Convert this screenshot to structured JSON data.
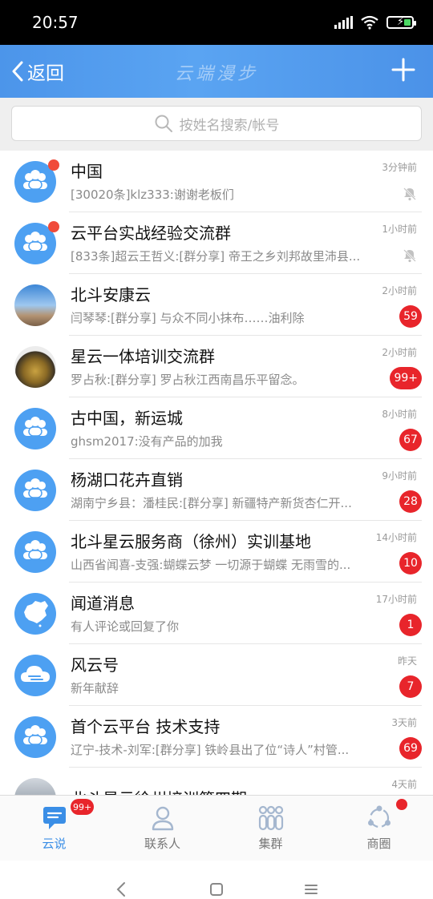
{
  "status": {
    "time": "20:57"
  },
  "nav": {
    "back_label": "返回",
    "watermark": "云端漫步"
  },
  "search": {
    "placeholder": "按姓名搜索/帐号"
  },
  "chats": [
    {
      "name": "中国",
      "preview": "[30020条]klz333:谢谢老板们",
      "time": "3分钟前",
      "badge": "",
      "muted": true,
      "avatar": "group",
      "dot": true
    },
    {
      "name": "云平台实战经验交流群",
      "preview": "[833条]超云王哲义:[群分享] 帝王之乡刘邦故里沛县...",
      "time": "1小时前",
      "badge": "",
      "muted": true,
      "avatar": "group",
      "dot": true
    },
    {
      "name": "北斗安康云",
      "preview": "闫琴琴:[群分享] 与众不同小抹布……油利除",
      "time": "2小时前",
      "badge": "59",
      "muted": false,
      "avatar": "photo1",
      "dot": false
    },
    {
      "name": "星云一体培训交流群",
      "preview": "罗占秋:[群分享] 罗占秋江西南昌乐平留念。",
      "time": "2小时前",
      "badge": "99+",
      "muted": false,
      "avatar": "photo2",
      "dot": false
    },
    {
      "name": "古中国，新运城",
      "preview": "ghsm2017:没有产品的加我",
      "time": "8小时前",
      "badge": "67",
      "muted": false,
      "avatar": "group",
      "dot": false
    },
    {
      "name": "杨湖口花卉直销",
      "preview": "湖南宁乡县：潘桂民:[群分享] 新疆特产新货杏仁开...",
      "time": "9小时前",
      "badge": "28",
      "muted": false,
      "avatar": "group",
      "dot": false
    },
    {
      "name": "北斗星云服务商（徐州）实训基地",
      "preview": "山西省闻喜-支强:蝴蝶云梦  一切源于蝴蝶 无雨雪的...",
      "time": "14小时前",
      "badge": "10",
      "muted": false,
      "avatar": "group",
      "dot": false
    },
    {
      "name": "闻道消息",
      "preview": "有人评论或回复了你",
      "time": "17小时前",
      "badge": "1",
      "muted": false,
      "avatar": "china",
      "dot": false
    },
    {
      "name": "风云号",
      "preview": "新年献辞",
      "time": "昨天",
      "badge": "7",
      "muted": false,
      "avatar": "cloud",
      "dot": false
    },
    {
      "name": "首个云平台 技术支持",
      "preview": "辽宁-技术-刘军:[群分享] 铁岭县出了位“诗人”村管...",
      "time": "3天前",
      "badge": "69",
      "muted": false,
      "avatar": "group",
      "dot": false
    },
    {
      "name": "北斗星云徐州培训第四期",
      "preview": "",
      "time": "4天前",
      "badge": "",
      "muted": false,
      "avatar": "photo3",
      "dot": false
    }
  ],
  "tabs": [
    {
      "label": "云说",
      "badge": "99+"
    },
    {
      "label": "联系人",
      "badge": ""
    },
    {
      "label": "集群",
      "badge": ""
    },
    {
      "label": "商圈",
      "badge": ""
    }
  ],
  "colors": {
    "primary": "#4a93e8",
    "badge": "#e8252b",
    "avatar": "#4da0f2"
  }
}
